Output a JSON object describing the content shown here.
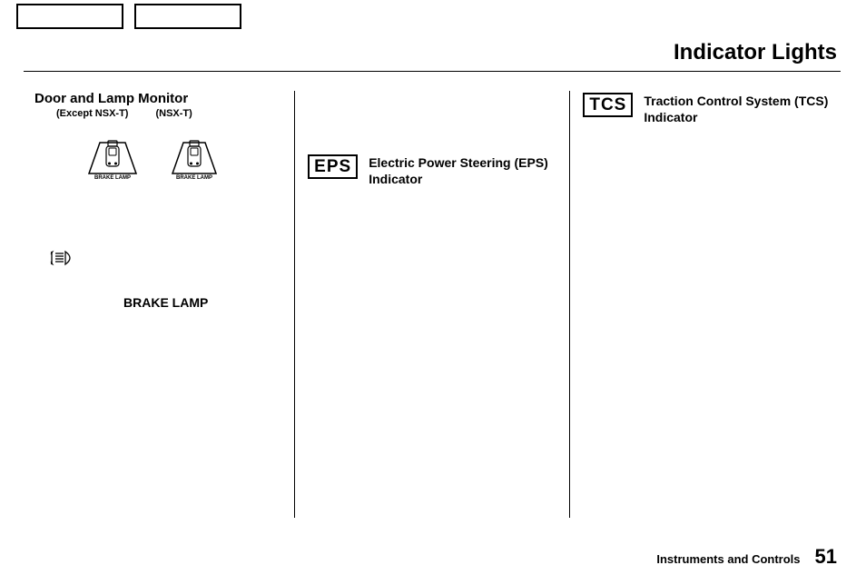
{
  "page_title": "Indicator Lights",
  "col1": {
    "title": "Door and Lamp Monitor",
    "subtitle_left": "(Except NSX-T)",
    "subtitle_right": "(NSX-T)",
    "icon_label": "BRAKE LAMP",
    "brake_lamp_text": "BRAKE LAMP"
  },
  "col2": {
    "badge": "EPS",
    "desc": "Electric Power Steering (EPS) Indicator"
  },
  "col3": {
    "badge": "TCS",
    "desc": "Traction Control System (TCS) Indicator"
  },
  "footer": {
    "label": "Instruments and Controls",
    "page": "51"
  }
}
